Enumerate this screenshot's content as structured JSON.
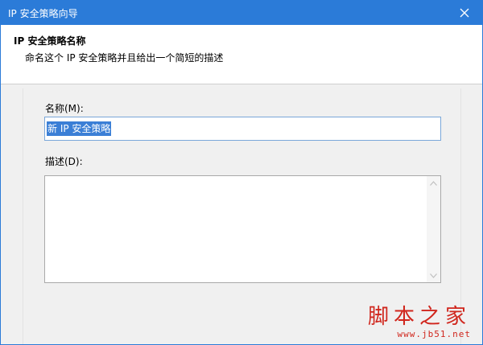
{
  "window": {
    "title": "IP 安全策略向导",
    "accent_color": "#2b7bd8",
    "close_icon": "close-icon"
  },
  "header": {
    "title": "IP 安全策略名称",
    "description": "命名这个 IP 安全策略并且给出一个简短的描述"
  },
  "form": {
    "name_label": "名称(M):",
    "name_value": "新 IP 安全策略",
    "description_label": "描述(D):",
    "description_value": ""
  },
  "watermark": {
    "text": "脚本之家",
    "url": "www.jb51.net"
  }
}
